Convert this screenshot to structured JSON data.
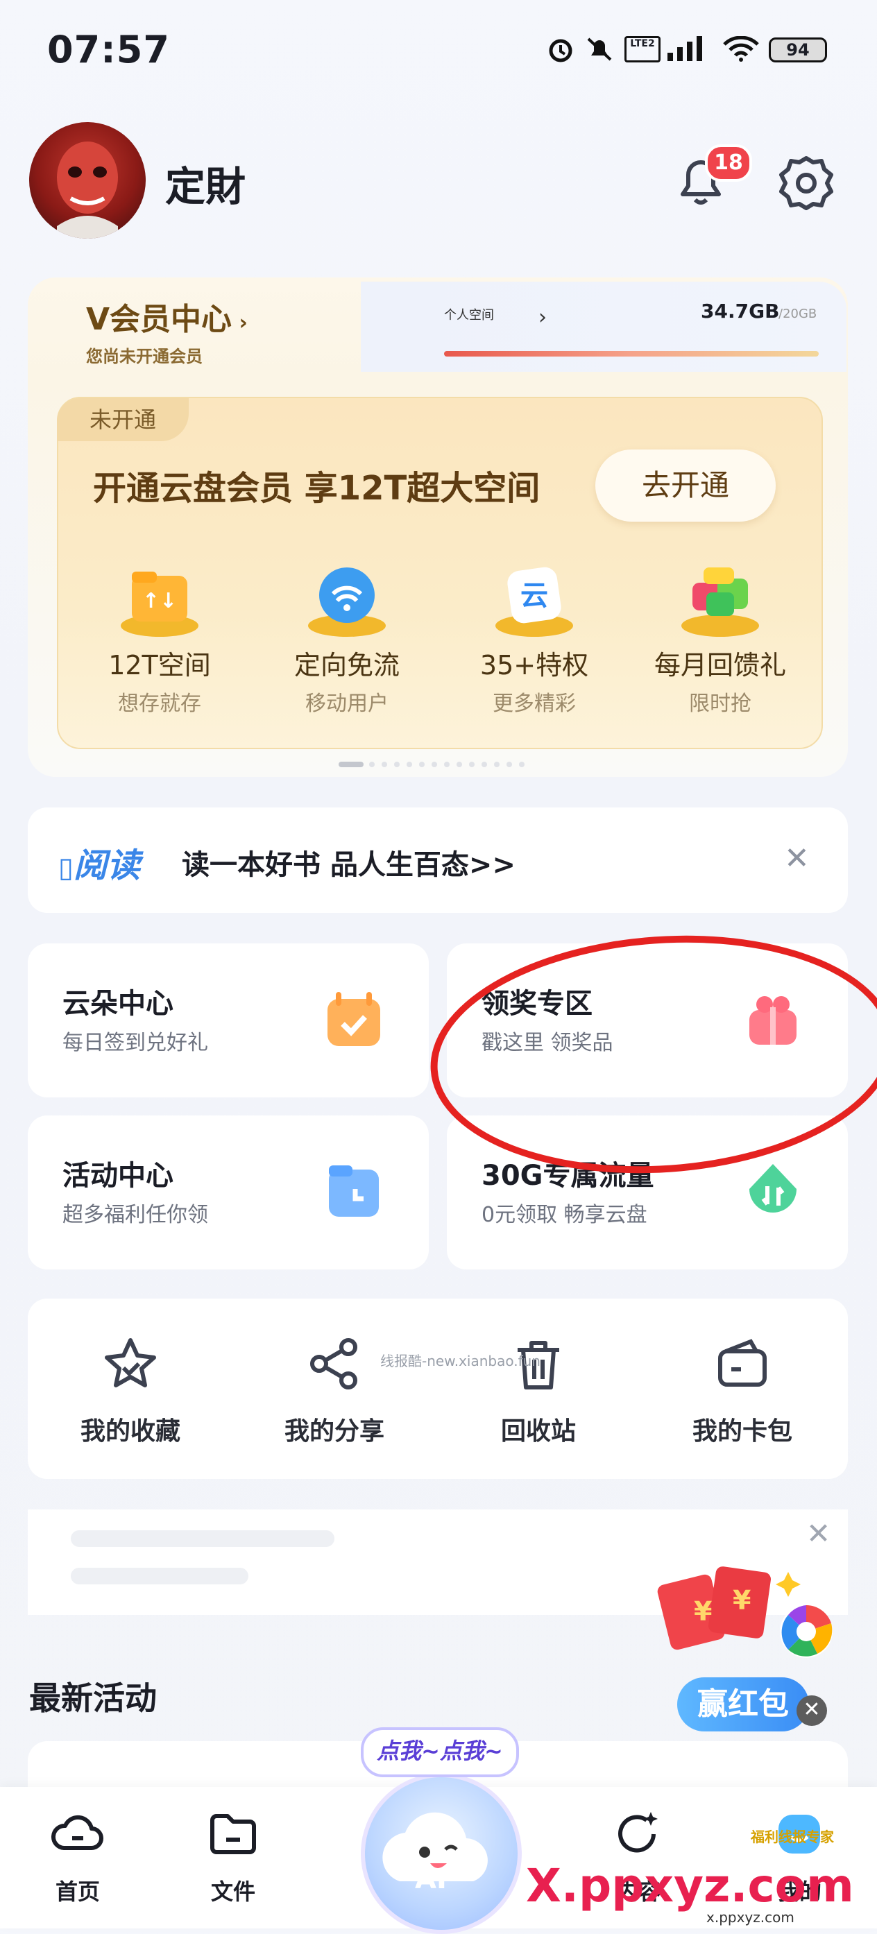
{
  "status_bar": {
    "time": "07:57",
    "battery": "94",
    "network": "LTE2"
  },
  "header": {
    "username": "定財",
    "notification_count": "18"
  },
  "member": {
    "title": "V会员中心",
    "subtitle": "您尚未开通会员",
    "space_label": "个人空间",
    "space_used": "34.7GB",
    "space_total": "/20GB",
    "promo_badge": "未开通",
    "promo_title": "开通云盘会员  享12T超大空间",
    "promo_button": "去开通",
    "perks": [
      {
        "name": "12T空间",
        "sub": "想存就存"
      },
      {
        "name": "定向免流",
        "sub": "移动用户"
      },
      {
        "name": "35+特权",
        "sub": "更多精彩"
      },
      {
        "name": "每月回馈礼",
        "sub": "限时抢"
      }
    ]
  },
  "reading": {
    "logo": "阅读",
    "text": "读一本好书  品人生百态>>"
  },
  "tiles": [
    {
      "title": "云朵中心",
      "sub": "每日签到兑好礼"
    },
    {
      "title": "领奖专区",
      "sub": "戳这里  领奖品"
    },
    {
      "title": "活动中心",
      "sub": "超多福利任你领"
    },
    {
      "title": "30G专属流量",
      "sub": "0元领取  畅享云盘"
    }
  ],
  "quick_actions": [
    {
      "label": "我的收藏"
    },
    {
      "label": "我的分享"
    },
    {
      "label": "回收站"
    },
    {
      "label": "我的卡包"
    }
  ],
  "watermark": "线报酷-new.xianbao.fun",
  "red_packet": {
    "label": "赢红包"
  },
  "latest": {
    "title": "最新活动"
  },
  "ai": {
    "bubble": "点我~点我~",
    "label": "AI"
  },
  "tabs": [
    {
      "label": "首页"
    },
    {
      "label": "文件"
    },
    {
      "label": "内容"
    },
    {
      "label": "我的"
    }
  ],
  "brand_watermark": {
    "main": "X.ppxyz.com",
    "sub": "x.ppxyz.com",
    "small": "福利线报专家"
  },
  "colors": {
    "accent_blue": "#3a86e8",
    "badge_red": "#f0434b",
    "vip_gold": "#6d4a14",
    "annotation_red": "#e52220"
  }
}
